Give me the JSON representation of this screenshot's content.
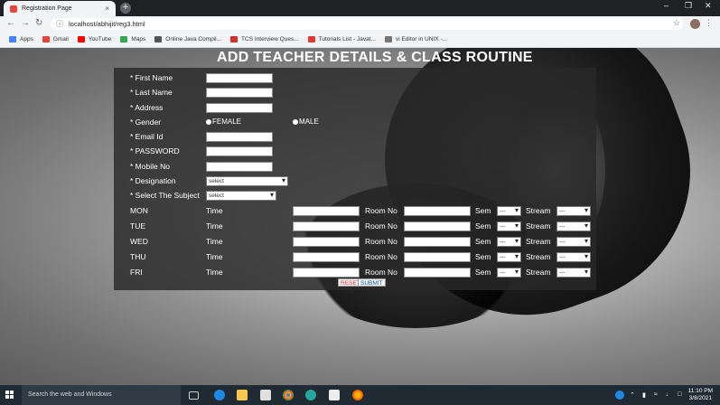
{
  "browser": {
    "tab_title": "Registration Page",
    "tab_close": "×",
    "new_tab": "+",
    "url": "localhost/abhijit/reg3.html",
    "bookmarks": [
      {
        "label": "Apps",
        "color": "#4285f4"
      },
      {
        "label": "Gmail",
        "color": "#ea4335"
      },
      {
        "label": "YouTube",
        "color": "#ff0000"
      },
      {
        "label": "Maps",
        "color": "#34a853"
      },
      {
        "label": "Online Java Compil...",
        "color": "#555555"
      },
      {
        "label": "TCS Interview Ques...",
        "color": "#d32f2f"
      },
      {
        "label": "Tutorials List - Javat...",
        "color": "#e53935"
      },
      {
        "label": "vi Editor in UNIX -...",
        "color": "#777777"
      }
    ]
  },
  "form": {
    "title": "ADD TEACHER DETAILS & CLASS ROUTINE",
    "fields": {
      "first_name": "* First Name",
      "last_name": "* Last Name",
      "address": "* Address",
      "gender": "* Gender",
      "email": "* Email Id",
      "password": "* PASSWORD",
      "mobile": "* Mobile No",
      "designation": "* Designation",
      "subject": "* Select The Subject"
    },
    "gender_options": {
      "female": "FEMALE",
      "male": "MALE"
    },
    "designation_selected": "select",
    "subject_selected": "select",
    "routine_labels": {
      "time": "Time",
      "room": "Room No",
      "sem": "Sem",
      "stream": "Stream"
    },
    "sem_selected": "---",
    "stream_selected": "---",
    "days": [
      "MON",
      "TUE",
      "WED",
      "THU",
      "FRI"
    ],
    "reset_label": "RESET",
    "submit_label": "SUBMIT"
  },
  "taskbar": {
    "search_placeholder": "Search the web and Windows",
    "time": "11:10 PM",
    "date": "3/8/2021"
  },
  "colors": {
    "accent_reset": "#e53935",
    "accent_submit": "#1565c0"
  }
}
